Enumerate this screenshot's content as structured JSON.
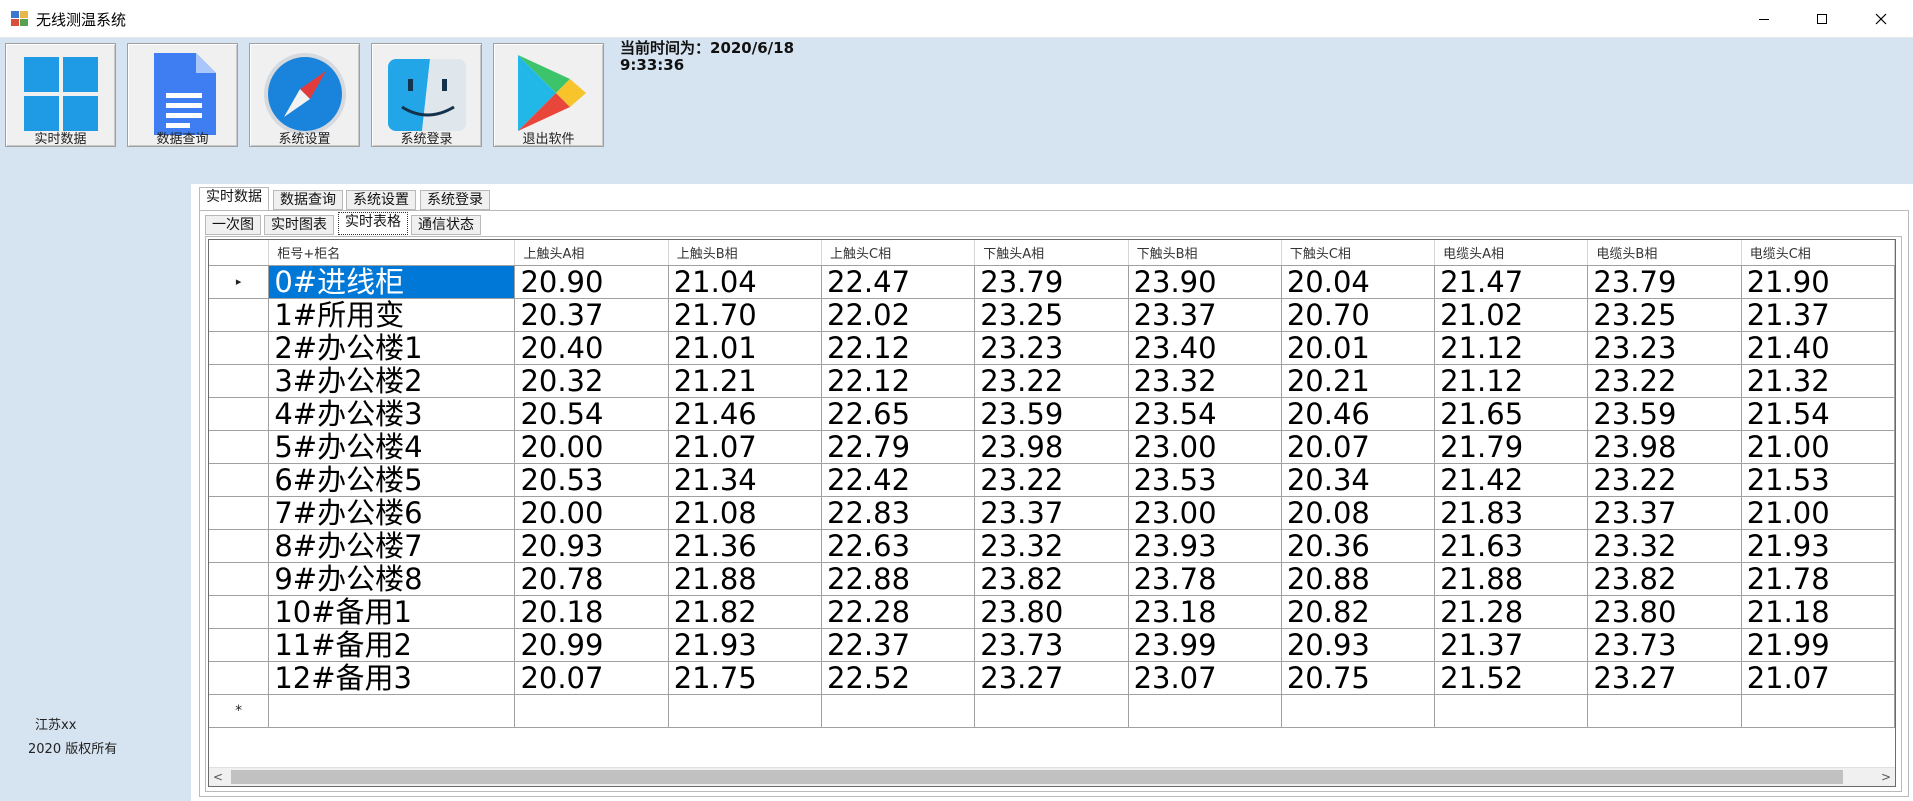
{
  "window": {
    "title": "无线测温系统",
    "controls": [
      "minimize-icon",
      "maximize-icon",
      "close-icon"
    ]
  },
  "toolbar": {
    "buttons": [
      {
        "label": "实时数据",
        "icon": "windows-logo-icon"
      },
      {
        "label": "数据查询",
        "icon": "document-icon"
      },
      {
        "label": "系统设置",
        "icon": "compass-icon"
      },
      {
        "label": "系统登录",
        "icon": "finder-face-icon"
      },
      {
        "label": "退出软件",
        "icon": "play-triangle-icon"
      }
    ],
    "time_label": "当前时间为：2020/6/18",
    "time_value": "9:33:36"
  },
  "sidebar": {
    "company": "江苏xx",
    "copyright": "2020 版权所有"
  },
  "main_tabs": [
    "实时数据",
    "数据查询",
    "系统设置",
    "系统登录"
  ],
  "main_tab_active": "实时数据",
  "sub_tabs": [
    "一次图",
    "实时图表",
    "实时表格",
    "通信状态"
  ],
  "sub_tab_active": "实时表格",
  "grid": {
    "columns": [
      "柜号+柜名",
      "上触头A相",
      "上触头B相",
      "上触头C相",
      "下触头A相",
      "下触头B相",
      "下触头C相",
      "电缆头A相",
      "电缆头B相",
      "电缆头C相"
    ],
    "rows": [
      [
        "0#进线柜",
        "20.90",
        "21.04",
        "22.47",
        "23.79",
        "23.90",
        "20.04",
        "21.47",
        "23.79",
        "21.90"
      ],
      [
        "1#所用变",
        "20.37",
        "21.70",
        "22.02",
        "23.25",
        "23.37",
        "20.70",
        "21.02",
        "23.25",
        "21.37"
      ],
      [
        "2#办公楼1",
        "20.40",
        "21.01",
        "22.12",
        "23.23",
        "23.40",
        "20.01",
        "21.12",
        "23.23",
        "21.40"
      ],
      [
        "3#办公楼2",
        "20.32",
        "21.21",
        "22.12",
        "23.22",
        "23.32",
        "20.21",
        "21.12",
        "23.22",
        "21.32"
      ],
      [
        "4#办公楼3",
        "20.54",
        "21.46",
        "22.65",
        "23.59",
        "23.54",
        "20.46",
        "21.65",
        "23.59",
        "21.54"
      ],
      [
        "5#办公楼4",
        "20.00",
        "21.07",
        "22.79",
        "23.98",
        "23.00",
        "20.07",
        "21.79",
        "23.98",
        "21.00"
      ],
      [
        "6#办公楼5",
        "20.53",
        "21.34",
        "22.42",
        "23.22",
        "23.53",
        "20.34",
        "21.42",
        "23.22",
        "21.53"
      ],
      [
        "7#办公楼6",
        "20.00",
        "21.08",
        "22.83",
        "23.37",
        "23.00",
        "20.08",
        "21.83",
        "23.37",
        "21.00"
      ],
      [
        "8#办公楼7",
        "20.93",
        "21.36",
        "22.63",
        "23.32",
        "23.93",
        "20.36",
        "21.63",
        "23.32",
        "21.93"
      ],
      [
        "9#办公楼8",
        "20.78",
        "21.88",
        "22.88",
        "23.82",
        "23.78",
        "20.88",
        "21.88",
        "23.82",
        "21.78"
      ],
      [
        "10#备用1",
        "20.18",
        "21.82",
        "22.28",
        "23.80",
        "23.18",
        "20.82",
        "21.28",
        "23.80",
        "21.18"
      ],
      [
        "11#备用2",
        "20.99",
        "21.93",
        "22.37",
        "23.73",
        "23.99",
        "20.93",
        "21.37",
        "23.73",
        "21.99"
      ],
      [
        "12#备用3",
        "20.07",
        "21.75",
        "22.52",
        "23.27",
        "23.07",
        "20.75",
        "21.52",
        "23.27",
        "21.07"
      ]
    ],
    "selected_row": 0,
    "selection_color": "#0078d7",
    "current_row_marker": "▸",
    "new_row_marker": "*"
  },
  "colors": {
    "panel_background": "#d6e3f0",
    "selection": "#0078d7"
  }
}
